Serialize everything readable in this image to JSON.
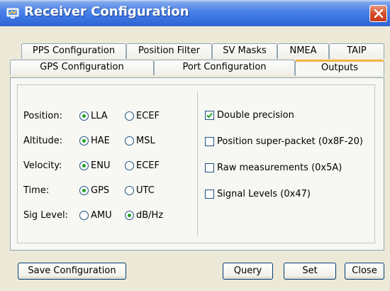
{
  "window": {
    "title": "Receiver Configuration"
  },
  "tabs": {
    "row1": [
      "PPS Configuration",
      "Position Filter",
      "SV Masks",
      "NMEA",
      "TAIP"
    ],
    "row2": [
      "GPS Configuration",
      "Port Configuration",
      "Outputs"
    ],
    "active": "Outputs"
  },
  "outputs": {
    "settings": [
      {
        "label": "Position:",
        "options": [
          "LLA",
          "ECEF"
        ],
        "selected": "LLA"
      },
      {
        "label": "Altitude:",
        "options": [
          "HAE",
          "MSL"
        ],
        "selected": "HAE"
      },
      {
        "label": "Velocity:",
        "options": [
          "ENU",
          "ECEF"
        ],
        "selected": "ENU"
      },
      {
        "label": "Time:",
        "options": [
          "GPS",
          "UTC"
        ],
        "selected": "GPS"
      },
      {
        "label": "Sig Level:",
        "options": [
          "AMU",
          "dB/Hz"
        ],
        "selected": "dB/Hz"
      }
    ],
    "checkboxes": [
      {
        "label": "Double precision",
        "checked": true
      },
      {
        "label": "Position super-packet (0x8F-20)",
        "checked": false
      },
      {
        "label": "Raw measurements (0x5A)",
        "checked": false
      },
      {
        "label": "Signal Levels (0x47)",
        "checked": false
      }
    ]
  },
  "buttons": {
    "save": "Save Configuration",
    "query": "Query",
    "set": "Set",
    "close": "Close"
  },
  "colors": {
    "titlebar": "#3a74e2",
    "window_bg": "#ece9d8",
    "panel_bg": "#f7f7f3",
    "active_tab_accent": "#f3b445",
    "radio_dot": "#21a121",
    "close_button": "#d54e2b"
  }
}
